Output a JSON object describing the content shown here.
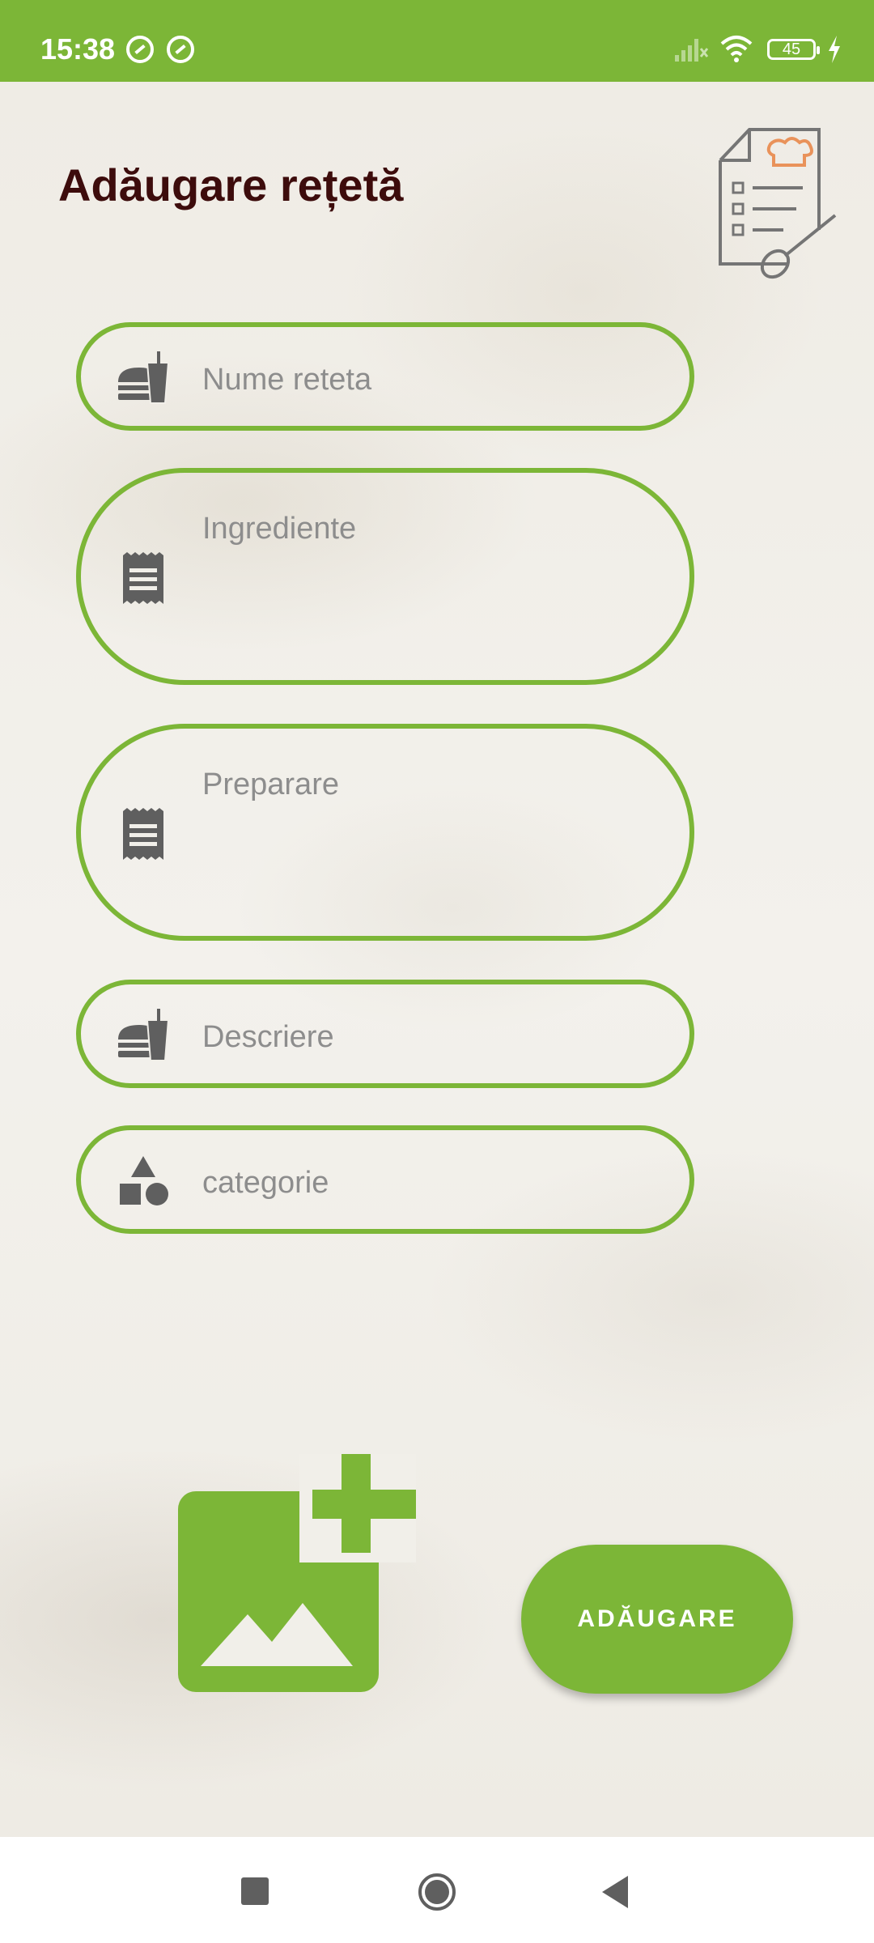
{
  "status_bar": {
    "time": "15:38",
    "battery": "45",
    "icons": [
      "sync-icon",
      "sync-icon",
      "signal-icon",
      "wifi-icon",
      "battery-icon",
      "charging-icon"
    ]
  },
  "page": {
    "title": "Adăugare rețetă",
    "header_icon": "recipe-list-icon"
  },
  "form": {
    "name": {
      "placeholder": "Nume reteta",
      "icon": "food-icon"
    },
    "ingredients": {
      "placeholder": "Ingrediente",
      "icon": "receipt-icon"
    },
    "preparation": {
      "placeholder": "Preparare",
      "icon": "receipt-icon"
    },
    "description": {
      "placeholder": "Descriere",
      "icon": "food-icon"
    },
    "category": {
      "placeholder": "categorie",
      "icon": "category-shapes-icon"
    }
  },
  "actions": {
    "add_image_icon": "add-photo-icon",
    "add_label": "ADĂUGARE"
  },
  "colors": {
    "accent": "#7cb637",
    "title": "#3d0c0c",
    "placeholder": "#8d8d8d",
    "icon": "#5f5f5f"
  }
}
